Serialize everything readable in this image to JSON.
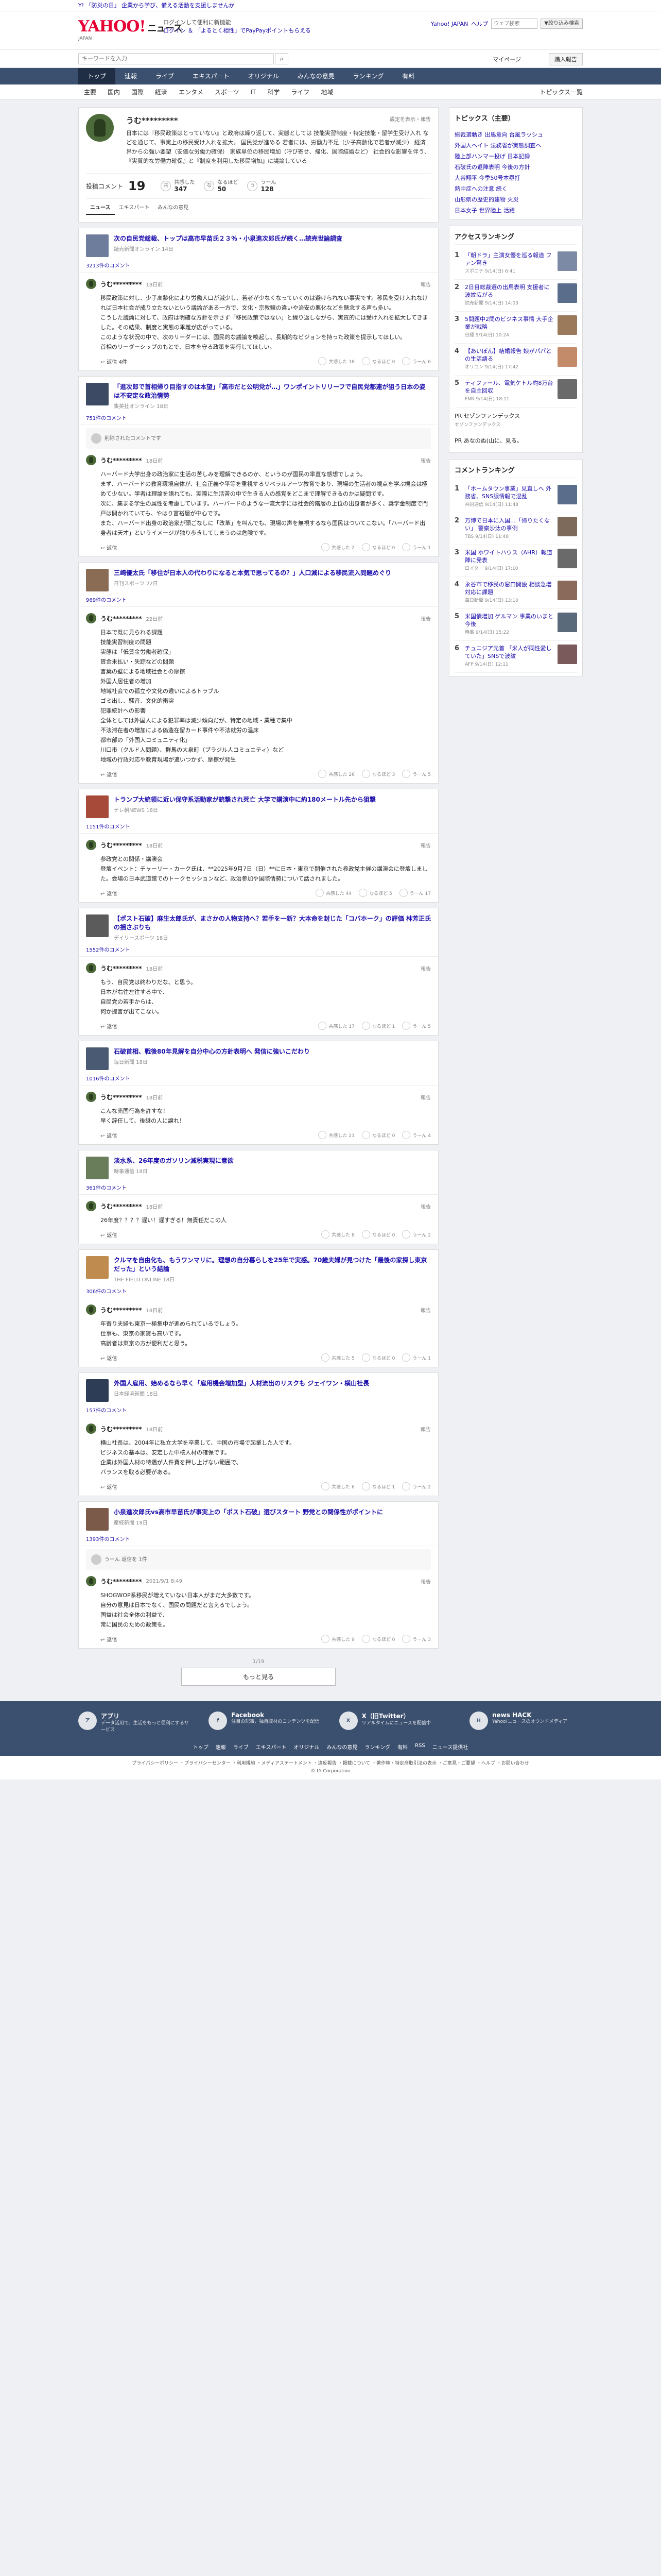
{
  "promo": "Y! 「防災の日」 企業から学び、備える活動を支援しませんか",
  "header": {
    "logo": "YAHOO!",
    "logo_suffix": "ニュース",
    "logo_sub": "JAPAN",
    "link1": "ログインして便利に新機能",
    "link2": "ログイン ＆ 「よるとく相性」でPayPayポイントもらえる",
    "yahoo_top": "Yahoo! JAPAN",
    "help": "ヘルプ",
    "search_placeholder": "ウェブ検索",
    "search_btn": "▼絞り込み検索"
  },
  "subbar": {
    "placeholder": "キーワードを入力",
    "mypage": "マイページ",
    "login": "購入報告"
  },
  "gnav": [
    "トップ",
    "速報",
    "ライブ",
    "エキスパート",
    "オリジナル",
    "みんなの意見",
    "ランキング",
    "有料"
  ],
  "snav": [
    "主要",
    "国内",
    "国際",
    "経済",
    "エンタメ",
    "スポーツ",
    "IT",
    "科学",
    "ライフ",
    "地域"
  ],
  "snav_topics": "トピックス一覧",
  "profile": {
    "name": "うむ*********",
    "edit": "設定を表示・報告",
    "bio": "日本には『移民政策はとっていない』と政府は繰り返して、実態としては 技能実習制度・特定技能・留学生受け入れ などを通じて、事実上の移民受け入れを拡大。 国民党が進める 若者には、労働力不足（少子高齢化で若者が減少） 経済界からの強い要望（安価な労働力確保） 家族単位の移民増加（呼び寄せ、帰化、国際結婚など） 社会的な影響を伴う、『実質的な労働力確保』と『制度を利用した移民増加』に議論している",
    "comments_label": "投稿コメント",
    "comments_count": "19",
    "reactions": [
      {
        "icon": "共",
        "label": "共感した",
        "value": "347"
      },
      {
        "icon": "な",
        "label": "なるほど",
        "value": "50"
      },
      {
        "icon": "う",
        "label": "うーん",
        "value": "128"
      }
    ],
    "tabs": [
      "ニュース",
      "エキスパート",
      "みんなの意見"
    ]
  },
  "articles": [
    {
      "title": "次の自民党総裁、トップは高市早苗氏２３％・小泉進次郎氏が続く…読売世論調査",
      "source": "読売新聞オンライン 14日",
      "thumb": "#6f7d9c",
      "count": "3213件のコメント",
      "comment": {
        "name": "うむ*********",
        "time": "18日前",
        "body": "移民政策に対し、少子高齢化により労働人口が減少し、若者が少なくなっていくのは避けられない事実です。移民を受け入れなければ日本社会が成り立たないという議論がある一方で、文化・宗教観の違いや治安の悪化などを懸念する声も多い。\nこうした議論に対して、政府は明確な方針を示さず「移民政策ではない」と繰り返しながら、実質的には受け入れを拡大してきました。その結果、制度と実態の乖離が広がっている。\nこのような状況の中で、次のリーダーには、国民的な議論を喚起し、長期的なビジョンを持った政策を提示してほしい。\n首相のリーダーシップのもとで、日本を守る政策を実行してほしい。",
        "reply": "返信 4件",
        "votes": [
          "共感した 18",
          "なるほど 0",
          "うーん 6"
        ]
      }
    },
    {
      "title": "「進次郎で首相帰り目指すのは本望」「高市だと公明党が…」ワンポイントリリーフで自民党都連が狙う日本の姿は不安定な政治情勢",
      "source": "集英社オンライン 18日",
      "thumb": "#3d4a63",
      "count": "751件のコメント",
      "reply_card": "削除されたコメントです",
      "comment": {
        "name": "うむ*********",
        "time": "18日前",
        "body": "ハーバード大学出身の政治家に生活の苦しみを理解できるのか、というのが国民の率直な感想でしょう。\nまず、ハーバードの教育環境自体が、社会正義や平等を重視するリベラルアーツ教育であり、現場の生活者の視点を学ぶ機会は極めて少ない。学者は理論を語れても、実際に生活苦の中で生きる人の感覚をどこまで理解できるのかは疑問です。\n次に、集まる学生の属性を考慮しています。ハーバードのような一流大学には社会的階層の上位の出身者が多く、奨学金制度で門戸は開かれていても、やはり富裕層が中心です。\nまた、ハーバード出身の政治家が頭ごなしに「改革」を叫んでも、現場の声を無視するなら国民はついてこない。「ハーバード出身者は天才」というイメージが独り歩きしてしまうのは危険です。",
        "reply": "返信",
        "votes": [
          "共感した 2",
          "なるほど 0",
          "うーん 1"
        ]
      }
    },
    {
      "title": "三崎優太氏「移住が日本人の代わりになると本気で思ってるの？」人口減による移民流入問題めぐり",
      "source": "日刊スポーツ 22日",
      "thumb": "#8a6b54",
      "count": "969件のコメント",
      "comment": {
        "name": "うむ*********",
        "time": "22日前",
        "body": "日本で既に見られる課題\n技能実習制度の問題\n実態は「低賃金労働者確保」\n賃金未払い・失踪などの問題\n言葉の壁による地域社会との摩擦\n外国人居住者の増加\n地域社会での孤立や文化の違いによるトラブル\nゴミ出し、騒音、文化的衝突\n犯罪統計への影響\n全体としては外国人による犯罪率は減少傾向だが、特定の地域・業種で集中\n不法滞在者の増加による偽造在留カード事件や不法就労の温床\n都市部の「外国人コミュニティ化」\n川口市（クルド人問題）、群馬の大泉町（ブラジル人コミュニティ）など\n地域の行政対応や教育現場が追いつかず、摩擦が発生",
        "reply": "返信",
        "votes": [
          "共感した 26",
          "なるほど 3",
          "うーん 5"
        ]
      }
    },
    {
      "title": "トランプ大統領に近い保守系活動家が銃撃され死亡 大学で講演中に約180メートル先から狙撃",
      "source": "テレ朝NEWS 18日",
      "thumb": "#a74a3a",
      "count": "1151件のコメント",
      "comment": {
        "name": "うむ*********",
        "time": "18日前",
        "body": "参政党との関係・講演会\n登壇イベント：チャーリー・カーク氏は、**2025年9月7日（日）**に日本・東京で開催された参政党主催の講演会に登壇しました。会場の日本武道館でのトークセッションなど、政治参加や国際情勢について話されました。",
        "reply": "返信",
        "votes": [
          "共感した 44",
          "なるほど 5",
          "うーん 17"
        ]
      }
    },
    {
      "title": "【ポスト石破】麻生太郎氏が、まさかの人物支持へ？若手を一新？大本命を封じた「コバホーク」の評価 林芳正氏の揺さぶりも",
      "source": "デイリースポーツ 18日",
      "thumb": "#5b5b5b",
      "count": "1552件のコメント",
      "comment": {
        "name": "うむ*********",
        "time": "18日前",
        "body": "もう、自民党は終わりだな、と思う。\n日本が右往左往する中で、\n自民党の若手からは、\n何か提言が出てこない。",
        "reply": "返信",
        "votes": [
          "共感した 17",
          "なるほど 1",
          "うーん 5"
        ]
      }
    },
    {
      "title": "石破首相、戦後80年見解を自分中心の方針表明へ 発信に強いこだわり",
      "source": "毎日新聞 18日",
      "thumb": "#4a5a72",
      "count": "1016件のコメント",
      "comment": {
        "name": "うむ*********",
        "time": "18日前",
        "body": "こんな売国行為を許すな！\n早く辞任して、後継の人に譲れ！",
        "reply": "返信",
        "votes": [
          "共感した 21",
          "なるほど 0",
          "うーん 4"
        ]
      }
    },
    {
      "title": "淡水系、26年度のガソリン減税実現に意欲",
      "source": "時事通信 18日",
      "thumb": "#6a7d5a",
      "count": "361件のコメント",
      "comment": {
        "name": "うむ*********",
        "time": "18日前",
        "body": "26年度？？？？遅い！遅すぎる！無責任だこの人",
        "reply": "返信",
        "votes": [
          "共感した 8",
          "なるほど 0",
          "うーん 2"
        ]
      }
    },
    {
      "title": "クルマを自由化も、もうワンマリに。理想の自分暮らしを25年で実感。70歳夫婦が見つけた「最後の家探し東京だった」という結論",
      "source": "THE FIELD ONLINE 18日",
      "thumb": "#c08b4e",
      "count": "306件のコメント",
      "comment": {
        "name": "うむ*********",
        "time": "18日前",
        "body": "年寄り夫婦も東京一極集中が進められているでしょう。\n仕事も、東京の家賃も高いです。\n高齢者は東京の方が便利だと思う。",
        "reply": "返信",
        "votes": [
          "共感した 5",
          "なるほど 0",
          "うーん 1"
        ]
      }
    },
    {
      "title": "外国人雇用、始めるなら早く「雇用機会増加型」人材流出のリスクも ジェイワン・横山社長",
      "source": "日本経済新聞 18日",
      "thumb": "#2d3d55",
      "count": "157件のコメント",
      "comment": {
        "name": "うむ*********",
        "time": "18日前",
        "body": "横山社長は、2004年に私立大学を卒業して、中国の市場で起業した人です。\nビジネスの基本は、安定した中核人材の確保です。\n企業は外国人材の待遇が人件費を押し上げない範囲で、\nバランスを取る必要がある。",
        "reply": "返信",
        "votes": [
          "共感した 6",
          "なるほど 1",
          "うーん 2"
        ]
      }
    },
    {
      "title": "小泉進次郎氏vs高市早苗氏が事実上の「ポスト石破」選びスタート 野党との関係性がポイントに",
      "source": "産経新聞 18日",
      "thumb": "#7b5a4a",
      "count": "1393件のコメント",
      "reply_card": "うーん 返信を 1件",
      "comment": {
        "name": "うむ*********",
        "time": "2021/9/1 8:49",
        "body": "SHOGWOP系移民が増えていない日本人がまだ大多数です。\n自分の意見は日本でなく、国民の問題だと言えるでしょう。\n国益は社会全体の利益で、\n常に国民のための政策を。",
        "reply": "返信",
        "votes": [
          "共感した 9",
          "なるほど 0",
          "うーん 3"
        ]
      }
    }
  ],
  "pager": "1/19",
  "more": "もっと見る",
  "sidebar": {
    "topics_title": "トピックス（主要）",
    "topics": [
      "総裁選動き 出馬意向 台風ラッシュ",
      "外国人ヘイト 法務省が実態調査へ",
      "陸上部ハンマー投げ 日本記録",
      "石破氏の退陣表明 今後の方針",
      "大谷翔平 今季50号本塁打",
      "熱中症への注意 続く",
      "山形県の歴史的建物 火災",
      "日本女子 世界陸上 活躍"
    ],
    "access_title": "アクセスランキング",
    "access": [
      {
        "t": "「朝ドラ」主演女優を巡る報道 ファン驚き",
        "s": "スポニチ 9/14(日) 6:41",
        "c": "#7d8aa5"
      },
      {
        "t": "2日目総裁選の出馬表明 支援者に波紋広がる",
        "s": "読売新聞 9/14(日) 14:03",
        "c": "#5a6d8a"
      },
      {
        "t": "5問題中2問のビジネス事情 大手企業が戦略",
        "s": "日経 9/14(日) 10:24",
        "c": "#9a7a5a"
      },
      {
        "t": "【あいぽん】結婚報告 娘がパパとの生活語る",
        "s": "オリコン 9/14(日) 17:42",
        "c": "#c48b6a"
      },
      {
        "t": "ティファール、電気ケトル約8万台を自主回収",
        "s": "FNN 9/14(日) 18:11",
        "c": "#6a6a6a"
      }
    ],
    "pr1": "PR セゾンファンデックス",
    "pr1_sub": "セゾンファンデックス",
    "pr2": "PR あなのぬ(山に、見る。",
    "comment_title": "コメントランキング",
    "comment_rank": [
      {
        "t": "「ホームタウン事業」見直しへ 外務省、SNS誤情報で混乱",
        "s": "共同通信 9/14(日) 11:48",
        "c": "#5a6d8a"
      },
      {
        "t": "万博で日本に入国…「帰りたくない」 警察沙汰の事例",
        "s": "TBS 9/14(日) 11:48",
        "c": "#7d6a5a"
      },
      {
        "t": "米国 ホワイトハウス（AHR）報道陣に発表",
        "s": "ロイター 9/14(日) 17:10",
        "c": "#6a6a6a"
      },
      {
        "t": "永谷市で移民の窓口開設 相談急増 対応に課題",
        "s": "毎日新聞 9/14(日) 13:10",
        "c": "#8a6a5a"
      },
      {
        "t": "米国債増加 ゲルマン 事業のいまと今後",
        "s": "時事 9/14(日) 15:22",
        "c": "#5a6a7a"
      },
      {
        "t": "チュニジア元首 「米人が同性愛していた」SNSで波紋",
        "s": "AFP 9/14(日) 12:11",
        "c": "#7a5a5a"
      }
    ]
  },
  "footer": {
    "items": [
      {
        "icon": "ア",
        "t": "アプリ",
        "s": "データ活用で、生活をもっと便利にするサービス"
      },
      {
        "icon": "f",
        "t": "Facebook",
        "s": "注目の記事、独自取材のコンテンツを配信"
      },
      {
        "icon": "X",
        "t": "X（旧Twitter）",
        "s": "リアルタイムにニュースを配信中"
      },
      {
        "icon": "H",
        "t": "news HACK",
        "s": "Yahoo!ニュースのオウンドメディア"
      }
    ],
    "links": [
      "トップ",
      "速報",
      "ライブ",
      "エキスパート",
      "オリジナル",
      "みんなの意見",
      "ランキング",
      "有料",
      "RSS",
      "ニュース提供社"
    ],
    "legal": "プライバシーポリシー ・プライバシーセンター ・利用規約 ・メディアステートメント ・違反報告 ・掲載について ・著作権・特定商取引法の表示 ・ご意見・ご要望 ・ヘルプ ・お問い合わせ",
    "copyright": "© LY Corporation"
  }
}
